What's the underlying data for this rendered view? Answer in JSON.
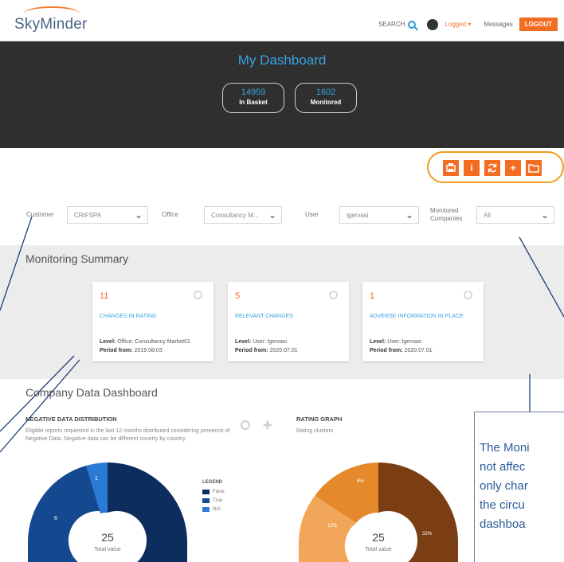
{
  "header": {
    "logo": "SkyMinder",
    "search_label": "SEARCH",
    "user_label": "Logged ▾",
    "messages_label": "Messages",
    "logout_label": "LOGOUT"
  },
  "hero": {
    "title": "My Dashboard",
    "stats": [
      {
        "value": "14959",
        "label": "In Basket"
      },
      {
        "value": "1602",
        "label": "Monitored"
      }
    ]
  },
  "toolbar": {
    "icons": [
      "print-icon",
      "info-icon",
      "refresh-icon",
      "add-icon",
      "folder-icon"
    ],
    "info_glyph": "i",
    "add_glyph": "+"
  },
  "filters": {
    "customer_label": "Customer",
    "customer_value": "CRIFSPA",
    "office_label": "Office",
    "office_value": "Consultancy M...",
    "user_label": "User",
    "user_value": "lgervasi",
    "monitored_label": "Monitored Companies",
    "monitored_value": "All"
  },
  "summary": {
    "title": "Monitoring Summary",
    "cards": [
      {
        "count": "11",
        "title": "CHANGES IN RATING",
        "level_key": "Level:",
        "level": "Office: Consultancy Market01",
        "period_key": "Period from:",
        "period": "2019.08.03"
      },
      {
        "count": "5",
        "title": "RELEVANT CHANGES",
        "level_key": "Level:",
        "level": "User: lgervasi",
        "period_key": "Period from:",
        "period": "2020.07.01"
      },
      {
        "count": "1",
        "title": "ADVERSE INFORMATION IN PLACE",
        "level_key": "Level:",
        "level": "User: lgervasi",
        "period_key": "Period from:",
        "period": "2020.07.01"
      }
    ]
  },
  "company": {
    "title": "Company Data Dashboard",
    "negative_title": "NEGATIVE DATA DISTRIBUTION",
    "negative_desc": "Eligible reports requested in the last 12 months distributed considering presence of Negative Data. Negative data can be different country by country.",
    "rating_title": "RATING GRAPH",
    "rating_desc": "Rating clusters",
    "legend_title": "LEGEND",
    "legend": [
      {
        "label": "False",
        "color": "#0c2d5e"
      },
      {
        "label": "True",
        "color": "#14488f"
      },
      {
        "label": "N/A",
        "color": "#2b7bd6"
      }
    ],
    "donut_left": {
      "total": "25",
      "total_label": "Total value",
      "slice_labels": [
        "1",
        "6"
      ]
    },
    "donut_right": {
      "total": "25",
      "total_label": "Total value",
      "slice_labels": [
        "8%",
        "12%",
        "32%"
      ]
    }
  },
  "callout": {
    "text": "The Moni\nnot affec\nonly char\nthe circu\ndashboa"
  },
  "colors": {
    "accent": "#f26c22",
    "link": "#3aa3e0",
    "annotation": "#1f3f7a",
    "highlight_ring": "#f39c1e"
  }
}
